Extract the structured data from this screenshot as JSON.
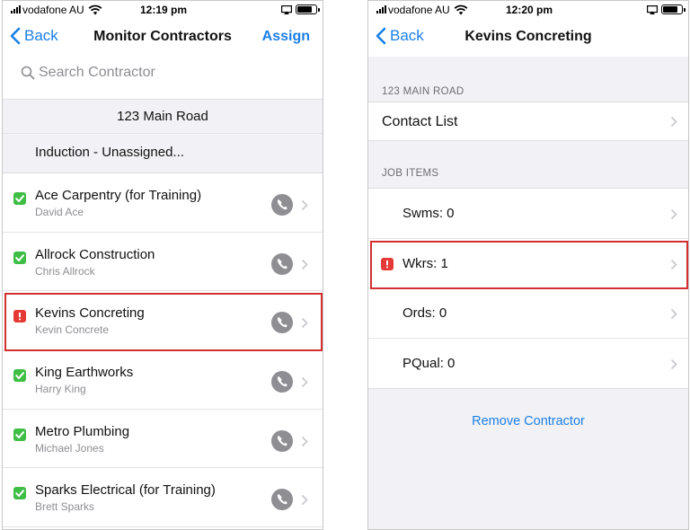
{
  "left": {
    "status": {
      "carrier": "vodafone AU",
      "time": "12:19 pm"
    },
    "nav": {
      "back_label": "Back",
      "title": "Monitor Contractors",
      "action_label": "Assign"
    },
    "search": {
      "placeholder": "Search Contractor"
    },
    "site": "123 Main Road",
    "induction": "Induction - Unassigned...",
    "contractors": [
      {
        "name": "Ace Carpentry (for Training)",
        "person": "David Ace",
        "status": "ok"
      },
      {
        "name": "Allrock Construction",
        "person": "Chris Allrock",
        "status": "ok"
      },
      {
        "name": "Kevins Concreting",
        "person": "Kevin Concrete",
        "status": "warning",
        "highlighted": true
      },
      {
        "name": "King Earthworks",
        "person": "Harry King",
        "status": "ok"
      },
      {
        "name": "Metro Plumbing",
        "person": "Michael Jones",
        "status": "ok"
      },
      {
        "name": "Sparks Electrical (for Training)",
        "person": "Brett Sparks",
        "status": "ok"
      }
    ]
  },
  "right": {
    "status": {
      "carrier": "vodafone AU",
      "time": "12:20 pm"
    },
    "nav": {
      "back_label": "Back",
      "title": "Kevins Concreting"
    },
    "site_header": "123 MAIN ROAD",
    "contact_list_label": "Contact List",
    "job_items_header": "JOB ITEMS",
    "job_items": [
      {
        "label": "Swms: 0",
        "status": "none"
      },
      {
        "label": "Wkrs: 1",
        "status": "warning",
        "highlighted": true
      },
      {
        "label": "Ords: 0",
        "status": "none"
      },
      {
        "label": "PQual: 0",
        "status": "none"
      }
    ],
    "remove_label": "Remove Contractor"
  },
  "colors": {
    "accent": "#1a7fe6",
    "ok": "#3fbe45",
    "warning": "#e53935",
    "highlight": "#d32f2f"
  },
  "icons": [
    "cellular-signal-icon",
    "wifi-icon",
    "airplay-icon",
    "battery-icon",
    "back-chevron-icon",
    "search-icon",
    "checkmark-icon",
    "exclamation-icon",
    "phone-icon",
    "chevron-right-icon"
  ]
}
